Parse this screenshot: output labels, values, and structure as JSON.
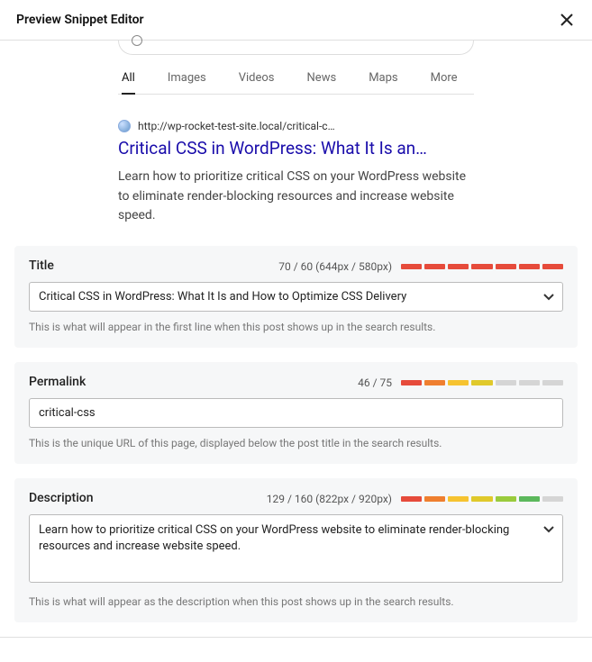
{
  "header": {
    "title": "Preview Snippet Editor"
  },
  "preview": {
    "tabs": {
      "all": "All",
      "images": "Images",
      "videos": "Videos",
      "news": "News",
      "maps": "Maps",
      "more": "More"
    },
    "url_display": "http://wp-rocket-test-site.local/critical-c…",
    "serp_title": "Critical CSS in WordPress: What It Is an…",
    "serp_description": "Learn how to prioritize critical CSS on your WordPress website to eliminate render-blocking resources and increase website speed."
  },
  "fields": {
    "title": {
      "label": "Title",
      "count": "70 / 60 (644px / 580px)",
      "value": "Critical CSS in WordPress: What It Is and How to Optimize CSS Delivery",
      "help": "This is what will appear in the first line when this post shows up in the search results.",
      "bar_colors": [
        "#e64b3b",
        "#e64b3b",
        "#e64b3b",
        "#e64b3b",
        "#e64b3b",
        "#e64b3b",
        "#e64b3b"
      ]
    },
    "permalink": {
      "label": "Permalink",
      "count": "46 / 75",
      "value": "critical-css",
      "help": "This is the unique URL of this page, displayed below the post title in the search results.",
      "bar_colors": [
        "#e64b3b",
        "#ef7f2f",
        "#f6c330",
        "#e0c92b",
        "#d5d5d5",
        "#d5d5d5",
        "#d5d5d5"
      ]
    },
    "description": {
      "label": "Description",
      "count": "129 / 160 (822px / 920px)",
      "value": "Learn how to prioritize critical CSS on your WordPress website to eliminate render-blocking resources and increase website speed.",
      "help": "This is what will appear as the description when this post shows up in the search results.",
      "bar_colors": [
        "#e64b3b",
        "#ef7f2f",
        "#f6c330",
        "#e0c92b",
        "#9acb3c",
        "#5cb85c",
        "#d5d5d5"
      ]
    }
  }
}
